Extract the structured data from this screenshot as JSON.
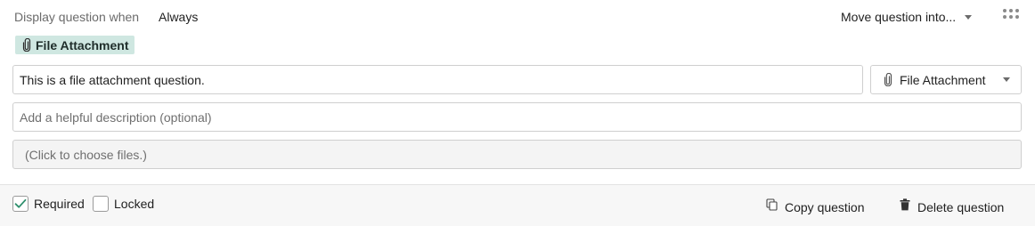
{
  "visibility": {
    "label": "Display question when",
    "value": "Always"
  },
  "toolbar": {
    "move_label": "Move question into...",
    "more_icon": "more-dots-icon"
  },
  "question": {
    "type_badge": "File Attachment",
    "title_value": "This is a file attachment question.",
    "description_placeholder": "Add a helpful description (optional)",
    "type_select_label": "File Attachment",
    "file_picker_label": "(Click to choose files.)",
    "type_icon": "paperclip-icon"
  },
  "footer": {
    "required_label": "Required",
    "required_checked": true,
    "locked_label": "Locked",
    "locked_checked": false,
    "copy_label": "Copy question",
    "delete_label": "Delete question"
  },
  "colors": {
    "badge_bg": "#cfe7e1",
    "check_green": "#2e8f6d",
    "footer_bg": "#f7f7f7"
  }
}
